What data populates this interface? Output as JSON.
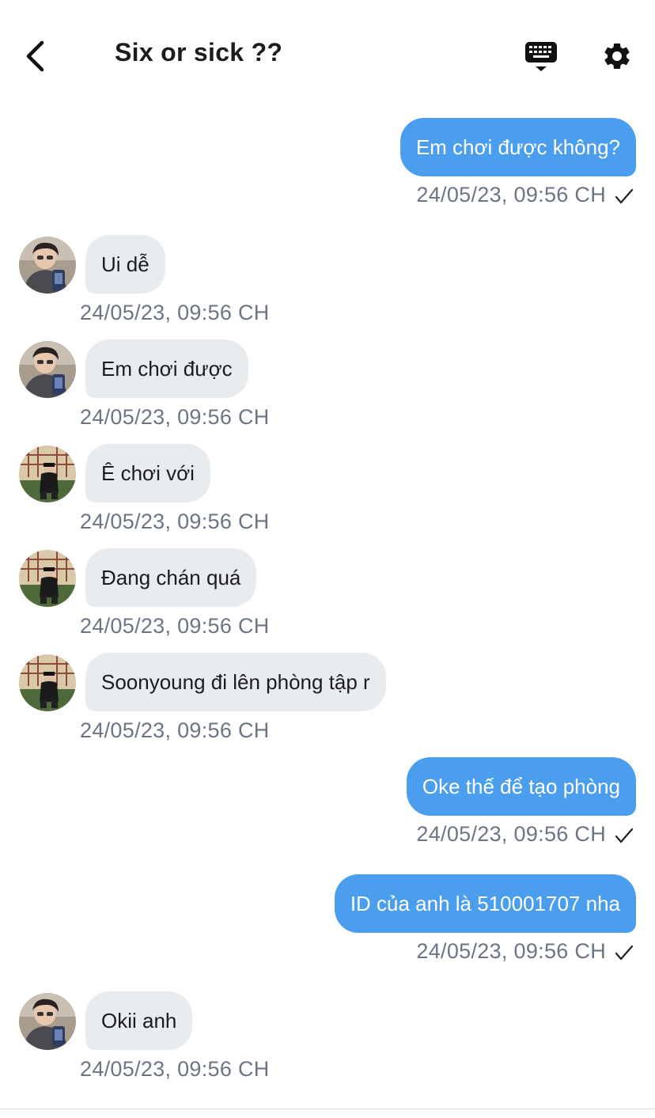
{
  "header": {
    "title": "Six or sick ??",
    "back_icon": "chevron-left-icon",
    "keyboard_icon": "keyboard-hide-icon",
    "settings_icon": "gear-icon"
  },
  "colors": {
    "outgoing_bubble": "#4b9ded",
    "incoming_bubble": "#e9ecef",
    "timestamp": "#6b7583"
  },
  "messages": [
    {
      "direction": "out",
      "text": "Em chơi được không?",
      "time": "24/05/23, 09:56 CH",
      "status_icon": "check-icon"
    },
    {
      "direction": "in",
      "avatar": "avatar-user-a",
      "text": "Ui dễ",
      "time": "24/05/23, 09:56 CH"
    },
    {
      "direction": "in",
      "avatar": "avatar-user-a",
      "text": "Em chơi được",
      "time": "24/05/23, 09:56 CH"
    },
    {
      "direction": "in",
      "avatar": "avatar-user-b",
      "text": "Ê chơi với",
      "time": "24/05/23, 09:56 CH"
    },
    {
      "direction": "in",
      "avatar": "avatar-user-b",
      "text": "Đang chán quá",
      "time": "24/05/23, 09:56 CH"
    },
    {
      "direction": "in",
      "avatar": "avatar-user-b",
      "text": "Soonyoung đi lên phòng tập r",
      "time": "24/05/23, 09:56 CH"
    },
    {
      "direction": "out",
      "text": "Oke thế để tạo phòng",
      "time": "24/05/23, 09:56 CH",
      "status_icon": "check-icon"
    },
    {
      "direction": "out",
      "text": "ID của anh là 510001707 nha",
      "time": "24/05/23, 09:56 CH",
      "status_icon": "check-icon"
    },
    {
      "direction": "in",
      "avatar": "avatar-user-a",
      "text": "Okii anh",
      "time": "24/05/23, 09:56 CH"
    }
  ]
}
